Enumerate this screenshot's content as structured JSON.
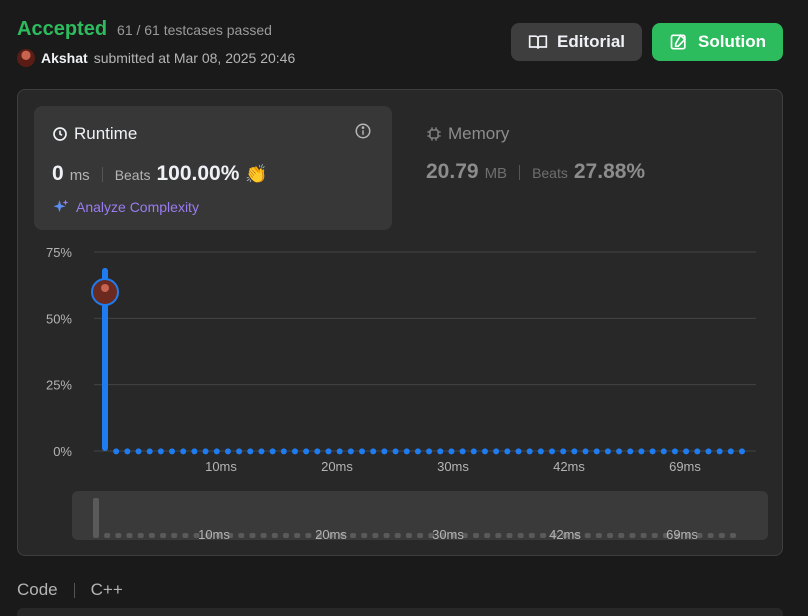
{
  "submission": {
    "status": "Accepted",
    "testcases": "61 / 61 testcases passed",
    "user": "Akshat",
    "submitted_text": "submitted at Mar 08, 2025 20:46"
  },
  "buttons": {
    "editorial": "Editorial",
    "solution": "Solution"
  },
  "runtime": {
    "title": "Runtime",
    "value": "0",
    "unit": "ms",
    "beats_label": "Beats",
    "beats_value": "100.00%",
    "analyze": "Analyze Complexity"
  },
  "memory": {
    "title": "Memory",
    "value": "20.79",
    "unit": "MB",
    "beats_label": "Beats",
    "beats_value": "27.88%"
  },
  "code": {
    "label": "Code",
    "language": "C++"
  },
  "colors": {
    "accent_green": "#2cbb5d",
    "bar_blue": "#1f7cf0",
    "purple": "#9b7cf0"
  },
  "chart_data": {
    "type": "bar",
    "y_ticks": [
      "75%",
      "50%",
      "25%",
      "0%"
    ],
    "ylim": [
      0,
      75
    ],
    "x_tick_labels": [
      "10ms",
      "20ms",
      "30ms",
      "42ms",
      "69ms"
    ],
    "first_bar_value": 69,
    "other_bar_value": 1,
    "bar_count": 58,
    "user_position_bar": 0
  }
}
